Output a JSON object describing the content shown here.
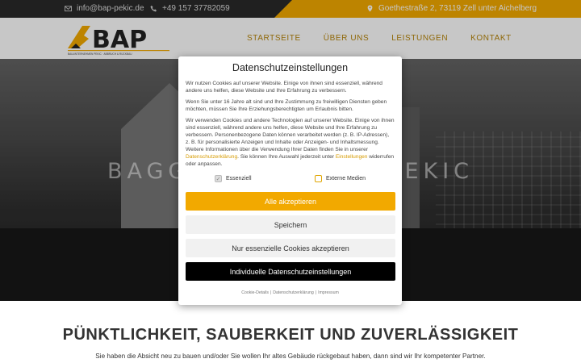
{
  "topbar": {
    "email": "info@bap-pekic.de",
    "phone": "+49 157 37782059",
    "address": "Goethestraße 2, 73119 Zell unter Aichelberg"
  },
  "header": {
    "logo_text": "BAP",
    "logo_subtext": "BAUUNTERNEHMEN PEKIC · ABBRUCH & RÜCKBAU",
    "nav": [
      {
        "label": "Startseite"
      },
      {
        "label": "Über uns"
      },
      {
        "label": "Leistungen"
      },
      {
        "label": "Kontakt"
      }
    ]
  },
  "hero": {
    "title": "BAGGERARBEITEN PEKIC"
  },
  "cookie_modal": {
    "title": "Datenschutzeinstellungen",
    "paragraph1": "Wir nutzen Cookies auf unserer Website. Einige von ihnen sind essenziell, während andere uns helfen, diese Website und Ihre Erfahrung zu verbessern.",
    "paragraph2": "Wenn Sie unter 16 Jahre alt sind und Ihre Zustimmung zu freiwilligen Diensten geben möchten, müssen Sie Ihre Erziehungsberechtigten um Erlaubnis bitten.",
    "paragraph3_a": "Wir verwenden Cookies und andere Technologien auf unserer Website. Einige von ihnen sind essenziell, während andere uns helfen, diese Website und Ihre Erfahrung zu verbessern. Personenbezogene Daten können verarbeitet werden (z. B. IP-Adressen), z. B. für personalisierte Anzeigen und Inhalte oder Anzeigen- und Inhaltsmessung. Weitere Informationen über die Verwendung Ihrer Daten finden Sie in unserer ",
    "paragraph3_link1": "Datenschutzerklärung",
    "paragraph3_b": ". Sie können Ihre Auswahl jederzeit unter ",
    "paragraph3_link2": "Einstellungen",
    "paragraph3_c": " widerrufen oder anpassen.",
    "checkbox_essential": "Essenziell",
    "checkbox_external": "Externe Medien",
    "accept_all": "Alle akzeptieren",
    "save": "Speichern",
    "accept_essential": "Nur essenzielle Cookies akzeptieren",
    "individual": "Individuelle Datenschutzeinstellungen",
    "footer_links": [
      "Cookie-Details",
      "Datenschutzerklärung",
      "Impressum"
    ]
  },
  "content": {
    "headline": "PÜNKTLICHKEIT, SAUBERKEIT UND ZUVERLÄSSIGKEIT",
    "subtext": "Sie haben die Absicht neu zu bauen und/oder Sie wollen Ihr altes Gebäude rückgebaut haben, dann sind wir Ihr kompetenter Partner."
  },
  "colors": {
    "accent": "#f2a900",
    "dark": "#2a2a2a"
  }
}
